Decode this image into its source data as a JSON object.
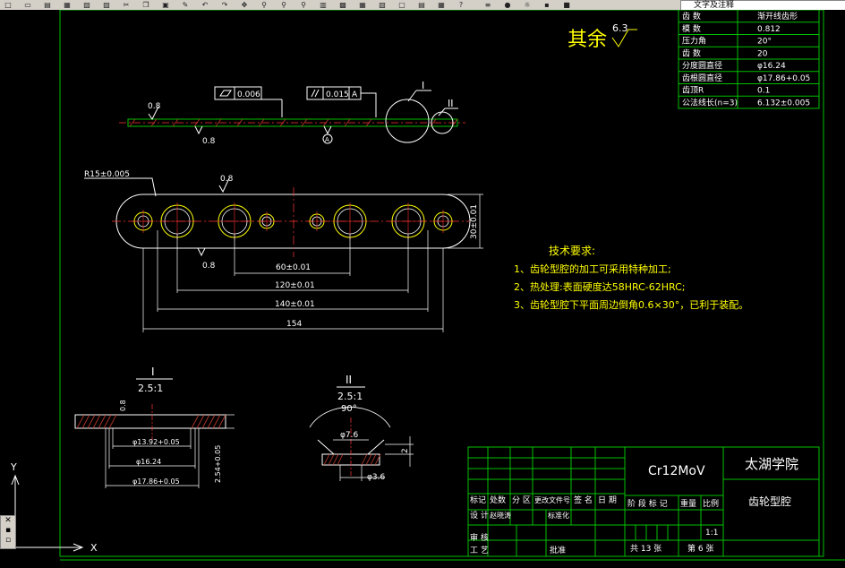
{
  "toolbar": {
    "layer_combo": "文字及注释",
    "icons": [
      "new-icon",
      "open-icon",
      "save-icon",
      "print-icon",
      "preview-icon",
      "plot-icon",
      "cut-icon",
      "copy-icon",
      "paste-icon",
      "match-icon",
      "undo-icon",
      "redo-icon",
      "pan-icon",
      "zoom-realtime-icon",
      "zoom-window-icon",
      "zoom-previous-icon",
      "properties-icon",
      "design-center-icon",
      "tool-palette-icon",
      "sheet-set-icon",
      "markup-icon",
      "calc-icon",
      "table-icon",
      "help-icon",
      "layer-icon",
      "bulb-icon",
      "sun-icon",
      "lock-icon",
      "color-icon"
    ]
  },
  "drawing": {
    "surface_finish": "其余",
    "surface_finish_value": "6.3",
    "gear_table": [
      [
        "齿 数",
        "渐开线齿形"
      ],
      [
        "模 数",
        "0.812"
      ],
      [
        "压力角",
        "20°"
      ],
      [
        "齿 数",
        "20"
      ],
      [
        "分度圆直径",
        "φ16.24"
      ],
      [
        "齿根圆直径",
        "φ17.86+0.05"
      ],
      [
        "齿顶R",
        "0.1"
      ],
      [
        "公法线长(n=3)",
        "6.132±0.005"
      ]
    ],
    "top_view": {
      "flatness_value": "0.006",
      "parallelism_value": "0.015",
      "datum": "A",
      "roughness": "0.8",
      "roughness_bottom": "0.8",
      "detail_1": "I",
      "detail_2": "II",
      "datum_label": "A"
    },
    "main_view": {
      "radius": "R15±0.005",
      "roughness": "0.8",
      "roughness_bottom": "0.8",
      "dim_60": "60±0.01",
      "dim_120": "120±0.01",
      "dim_140": "140±0.01",
      "dim_154": "154",
      "dim_height": "30±0.01"
    },
    "tech_req": {
      "title": "技术要求:",
      "items": [
        "1、齿轮型腔的加工可采用特种加工;",
        "2、热处理:表面硬度达58HRC-62HRC;",
        "3、齿轮型腔下平面周边倒角0.6×30°，已利于装配。"
      ]
    },
    "detail_i": {
      "label": "I",
      "scale": "2.5:1",
      "dim_a": "φ13.92+0.05",
      "dim_b": "φ16.24",
      "dim_c": "φ17.86+0.05",
      "dim_h": "2.54+0.05",
      "dim_r": "0.8"
    },
    "detail_ii": {
      "label": "II",
      "scale": "2.5:1",
      "angle": "90°",
      "dim_top": "φ7.6",
      "dim_bottom": "φ3.6",
      "dim_h": "2"
    },
    "title_block": {
      "material": "Cr12MoV",
      "school": "太湖学院",
      "part_name": "齿轮型腔",
      "row_labels": [
        "标记",
        "处数",
        "分 区",
        "更改文件号",
        "签 名",
        "日 期"
      ],
      "design": "设 计",
      "designer": "赵晓涛",
      "standardization": "标准化",
      "review": "审 核",
      "process": "工 艺",
      "approve": "批准",
      "stage": "阶 段 标 记",
      "weight": "重量",
      "scale_label": "比例",
      "scale": "1:1",
      "sheets": "共 13 张",
      "sheet_no": "第 6 张"
    },
    "ucs": {
      "y": "Y",
      "x": "X"
    }
  }
}
